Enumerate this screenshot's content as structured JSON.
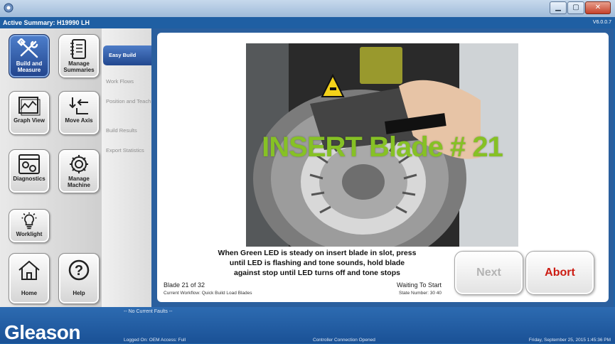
{
  "window": {
    "title": "",
    "buttons": {
      "minimize": "▁",
      "maximize": "▢",
      "close": "✕"
    }
  },
  "summary_bar": {
    "title": "Active Summary: H19990 LH",
    "version": "V6.0.0.7"
  },
  "toolbar": {
    "items": [
      {
        "label": "Build and Measure",
        "icon": "wrench-screwdriver-icon",
        "active": true
      },
      {
        "label": "Manage Summaries",
        "icon": "notebook-icon",
        "active": false
      },
      {
        "label": "Graph View",
        "icon": "graph-icon",
        "active": false
      },
      {
        "label": "Move Axis",
        "icon": "move-axis-icon",
        "active": false
      },
      {
        "label": "Diagnostics",
        "icon": "diagnostics-gear-icon",
        "active": false
      },
      {
        "label": "Manage Machine",
        "icon": "gear-icon",
        "active": false
      },
      {
        "label": "Worklight",
        "icon": "light-bulb-icon",
        "active": false
      },
      {
        "label": "Home",
        "icon": "home-icon",
        "active": false
      },
      {
        "label": "Help",
        "icon": "help-icon",
        "active": false
      }
    ]
  },
  "steps": [
    {
      "label": "Easy Build",
      "active": true
    },
    {
      "label": "Work Flows",
      "active": false
    },
    {
      "label": "Position and Teach",
      "active": false
    },
    {
      "label": "Build Results",
      "active": false
    },
    {
      "label": "Export Statistics",
      "active": false
    }
  ],
  "photo": {
    "overlay_text": "INSERT Blade # 21",
    "overlay_color": "#86c125",
    "warning_icon": "warning-hand-icon"
  },
  "instruction": [
    "When Green LED is steady on insert blade in slot, press",
    "until LED is flashing and tone sounds, hold blade",
    "against stop until LED turns off and tone stops"
  ],
  "progress": {
    "blade_count": "Blade 21 of 32",
    "workflow": "Current Workflow: Quick Build Load Blades",
    "status": "Waiting To Start",
    "state_number": "State Number: 30 40"
  },
  "actions": {
    "next_label": "Next",
    "abort_label": "Abort",
    "abort_color": "#cc1b12"
  },
  "footer": {
    "brand": "Gleason",
    "faults": "-- No Current Faults --",
    "logged_on": "Logged On: OEM  Access: Full",
    "connection": "Controller Connection Opened",
    "datetime": "Friday, September 25, 2015 1:45:36 PM"
  }
}
